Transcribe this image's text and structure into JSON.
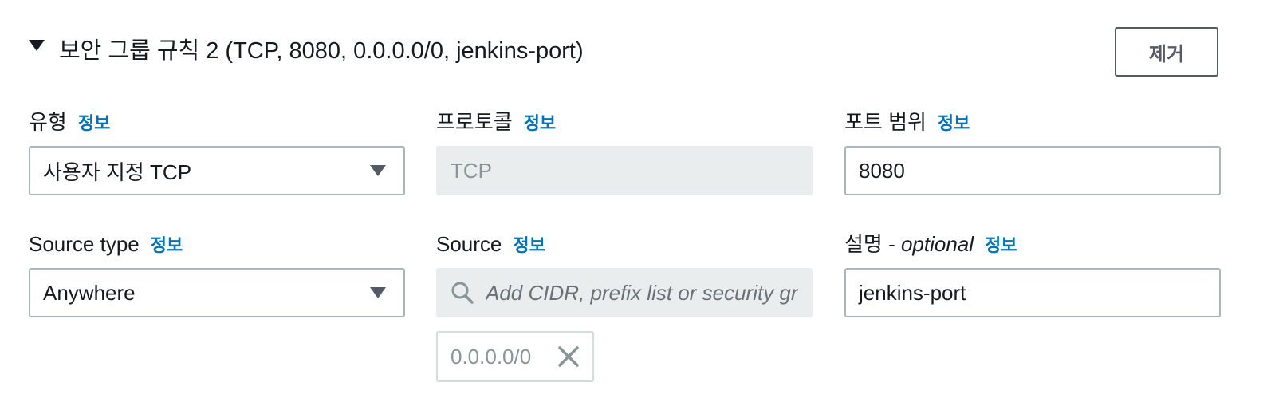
{
  "rule": {
    "title": "보안 그룹 규칙 2 (TCP, 8080, 0.0.0.0/0, jenkins-port)",
    "remove_label": "제거"
  },
  "info_label": "정보",
  "fields": {
    "type": {
      "label": "유형",
      "value": "사용자 지정 TCP"
    },
    "protocol": {
      "label": "프로토콜",
      "value": "TCP"
    },
    "port_range": {
      "label": "포트 범위",
      "value": "8080"
    },
    "source_type": {
      "label": "Source type",
      "value": "Anywhere"
    },
    "source": {
      "label": "Source",
      "placeholder": "Add CIDR, prefix list or security group",
      "token": "0.0.0.0/0"
    },
    "description": {
      "label": "설명 - ",
      "label_optional": "optional",
      "value": "jenkins-port"
    }
  },
  "colors": {
    "info_link": "#0073bb",
    "text": "#16191f",
    "disabled_bg": "#eaeded",
    "border": "#aab7b8"
  },
  "icons": {
    "expand": "caret-down-icon",
    "select": "triangle-down-icon",
    "search": "search-icon",
    "remove_token": "close-icon"
  }
}
